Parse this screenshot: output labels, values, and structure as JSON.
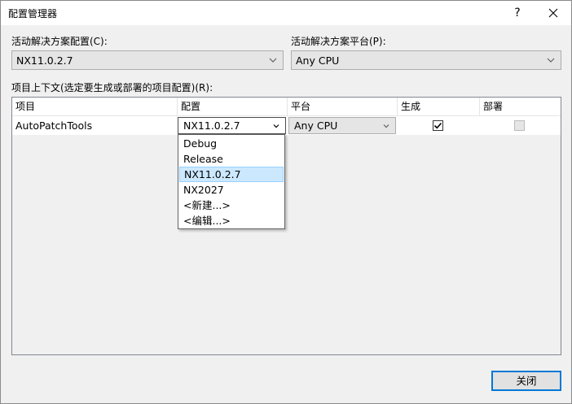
{
  "window": {
    "title": "配置管理器",
    "help_label": "?",
    "close_label": "✕"
  },
  "solution_config": {
    "label": "活动解决方案配置(C):",
    "value": "NX11.0.2.7"
  },
  "solution_platform": {
    "label": "活动解决方案平台(P):",
    "value": "Any CPU"
  },
  "project_context_label": "项目上下文(选定要生成或部署的项目配置)(R):",
  "grid": {
    "columns": [
      "项目",
      "配置",
      "平台",
      "生成",
      "部署"
    ],
    "rows": [
      {
        "project": "AutoPatchTools",
        "configuration": "NX11.0.2.7",
        "platform": "Any CPU",
        "build": true,
        "deploy": false
      }
    ]
  },
  "config_dropdown": {
    "items": [
      "Debug",
      "Release",
      "NX11.0.2.7",
      "NX2027",
      "<新建...>",
      "<编辑...>"
    ],
    "selected": "NX11.0.2.7"
  },
  "buttons": {
    "close_label": "关闭"
  }
}
